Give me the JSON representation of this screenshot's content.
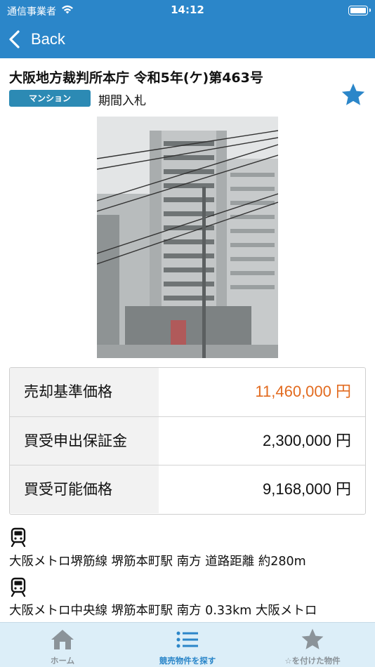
{
  "status_bar": {
    "carrier": "通信事業者",
    "time": "14:12"
  },
  "nav": {
    "back_label": "Back"
  },
  "property": {
    "title": "大阪地方裁判所本庁 令和5年(ケ)第463号",
    "type_badge": "マンション",
    "bid_type": "期間入札",
    "favorited": true,
    "photo_icon": "building-photo"
  },
  "prices": [
    {
      "label": "売却基準価格",
      "value": "11,460,000 円",
      "highlight": true
    },
    {
      "label": "買受申出保証金",
      "value": "2,300,000 円",
      "highlight": false
    },
    {
      "label": "買受可能価格",
      "value": "9,168,000 円",
      "highlight": false
    }
  ],
  "access": [
    {
      "icon": "train-icon",
      "text": "大阪メトロ堺筋線 堺筋本町駅 南方 道路距離 約280m"
    },
    {
      "icon": "train-icon",
      "text": "大阪メトロ中央線 堺筋本町駅 南方 0.33km 大阪メトロ"
    }
  ],
  "tabs": [
    {
      "label": "ホーム",
      "icon": "home-icon",
      "active": false
    },
    {
      "label": "競売物件を探す",
      "icon": "list-icon",
      "active": true
    },
    {
      "label": "☆を付けた物件",
      "icon": "star-icon",
      "active": false
    }
  ],
  "colors": {
    "primary": "#2b86c9",
    "badge": "#2c8ab4",
    "price_highlight": "#e26a1e",
    "tab_bar": "#dceef8"
  }
}
